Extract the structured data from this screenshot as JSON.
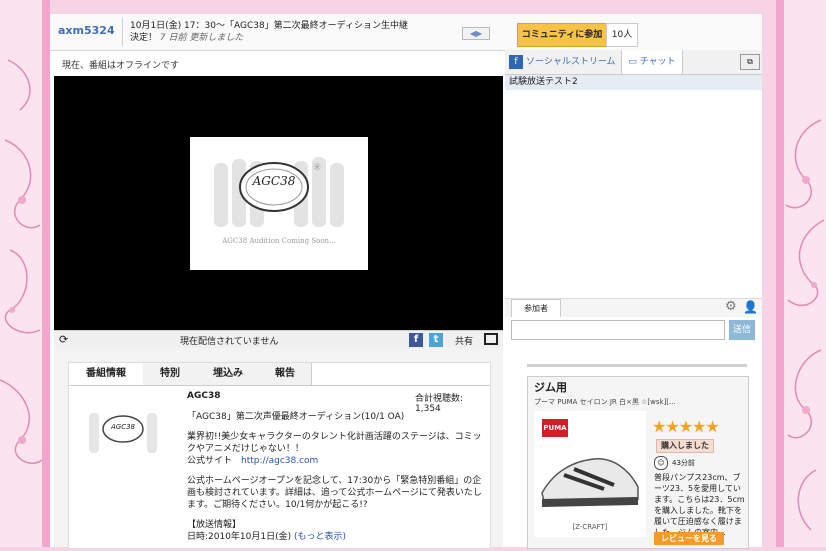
{
  "header": {
    "username": "axm5324",
    "title_line1": "10月1日(金) 17：30〜「AGC38」第二次最終オーディション生中継",
    "title_line2_prefix": "決定！",
    "updated": "7 日前 更新しました",
    "join_label": "コミュニティに参加",
    "member_count": "10人"
  },
  "player": {
    "status_text": "現在、番組はオフラインです",
    "logo_text": "AGC38",
    "logo_caption": "AGC38 Audition Coming Soon...",
    "bar_text": "現在配信されていません",
    "share_label": "共有"
  },
  "right_panel": {
    "tab_social": "ソーシャルストリーム",
    "tab_chat": "チャット",
    "chat_message": "試験放送テスト2",
    "participants_tab": "参加者",
    "send_label": "送信"
  },
  "info": {
    "tabs": [
      "番組情報",
      "特別",
      "埋込み",
      "報告"
    ],
    "channel_name": "AGC38",
    "view_count": "合計視聴数: 1,354",
    "desc_title": "「AGC38」第二次声優最終オーディション(10/1 OA)",
    "desc_para1": "業界初!!美少女キャラクターのタレント化計画活躍のステージは、コミックやアニメだけじゃない！！",
    "site_label": "公式サイト",
    "site_url": "http://agc38.com",
    "desc_para2": "公式ホームページオープンを記念して、17:30から「緊急特別番組」の企画も検討されています。詳細は、追って公式ホームページにて発表いたします。ご期待ください。10/1何かが起こる!?",
    "broadcast_header": "【放送情報】",
    "broadcast_date": "日時:2010年10月1日(金)",
    "show_more": "(もっと表示)"
  },
  "ad": {
    "title": "ジム用",
    "product": "プーマ PUMA セイロン JR 白×黒 ☆[wsk][...",
    "brand": "PUMA",
    "maker": "[Z-CRAFT]",
    "stars": "★★★★★",
    "bought_label": "購入しました",
    "ago": "43分前",
    "review": "普段パンプス23cm、ブーツ23．5を愛用しています。こちらは23．5cmを購入しました。靴下を履いて圧迫感なく履けました。ジムの室内...",
    "review_button": "レビューを見る"
  }
}
